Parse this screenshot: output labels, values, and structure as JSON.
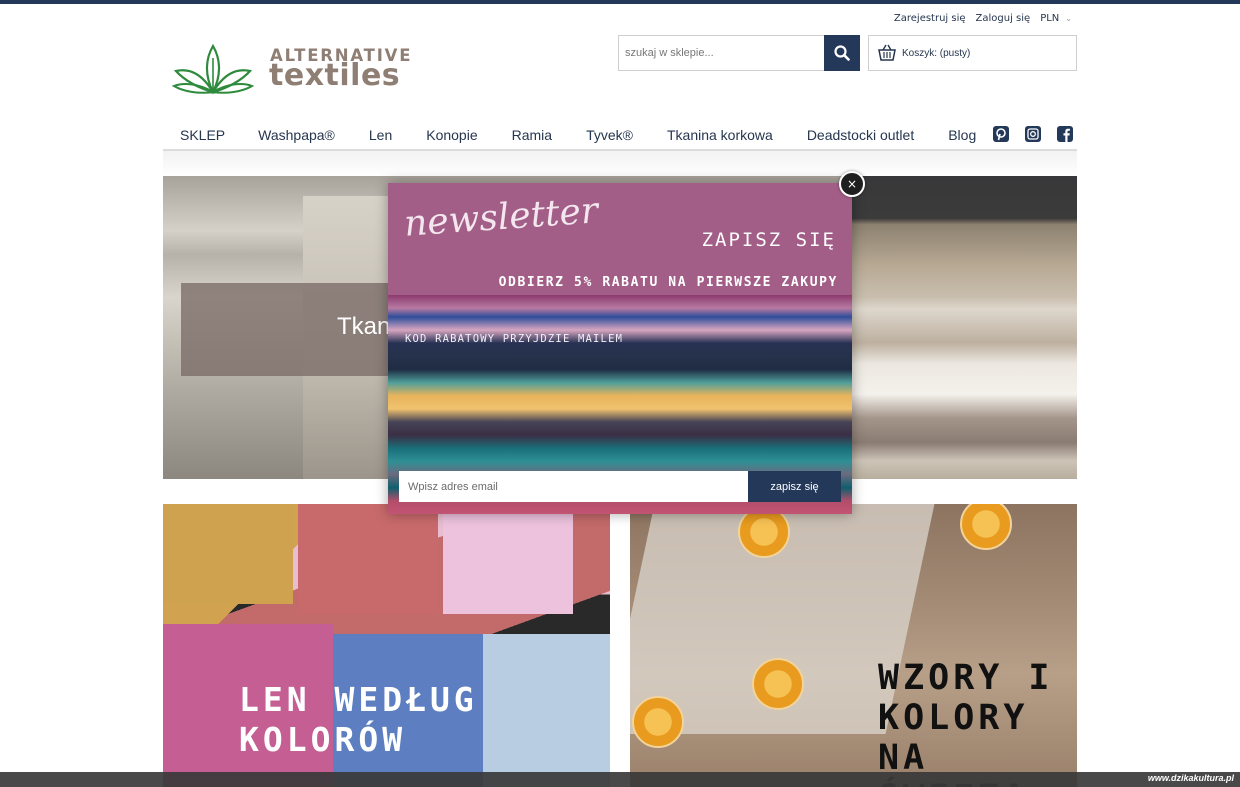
{
  "header": {
    "register_label": "Zarejestruj się",
    "login_label": "Zaloguj się",
    "currency": "PLN",
    "logo_line1": "ALTERNATIVE",
    "logo_line2": "textiles",
    "search_placeholder": "szukaj w sklepie...",
    "cart_label": "Koszyk: (pusty)"
  },
  "nav": {
    "items": [
      "SKLEP",
      "Washpapa®",
      "Len",
      "Konopie",
      "Ramia",
      "Tyvek®",
      "Tkanina korkowa",
      "Deadstocki outlet",
      "Blog"
    ],
    "social_icons": [
      "pinterest-icon",
      "instagram-icon",
      "facebook-icon"
    ]
  },
  "hero": {
    "caption": "Tkan"
  },
  "tiles": {
    "left_text": "LEN WEDŁUG\nKOLORÓW",
    "right_text": "WZORY I\nKOLORY NA\nŚWIĘTA"
  },
  "popup": {
    "title": "newsletter",
    "subscribe_heading": "ZAPISZ SIĘ",
    "discount_text": "ODBIERZ 5% RABATU NA PIERWSZE ZAKUPY",
    "code_text": "KOD RABATOWY PRZYJDZIE MAILEM",
    "email_placeholder": "Wpisz adres email",
    "submit_label": "zapisz się",
    "close_label": "×"
  },
  "watermark": "www.dzikakultura.pl",
  "colors": {
    "navy": "#24385a",
    "popup_head": "#a25e87",
    "logo_brown": "#8f7e74",
    "logo_green": "#2e8a3c"
  }
}
